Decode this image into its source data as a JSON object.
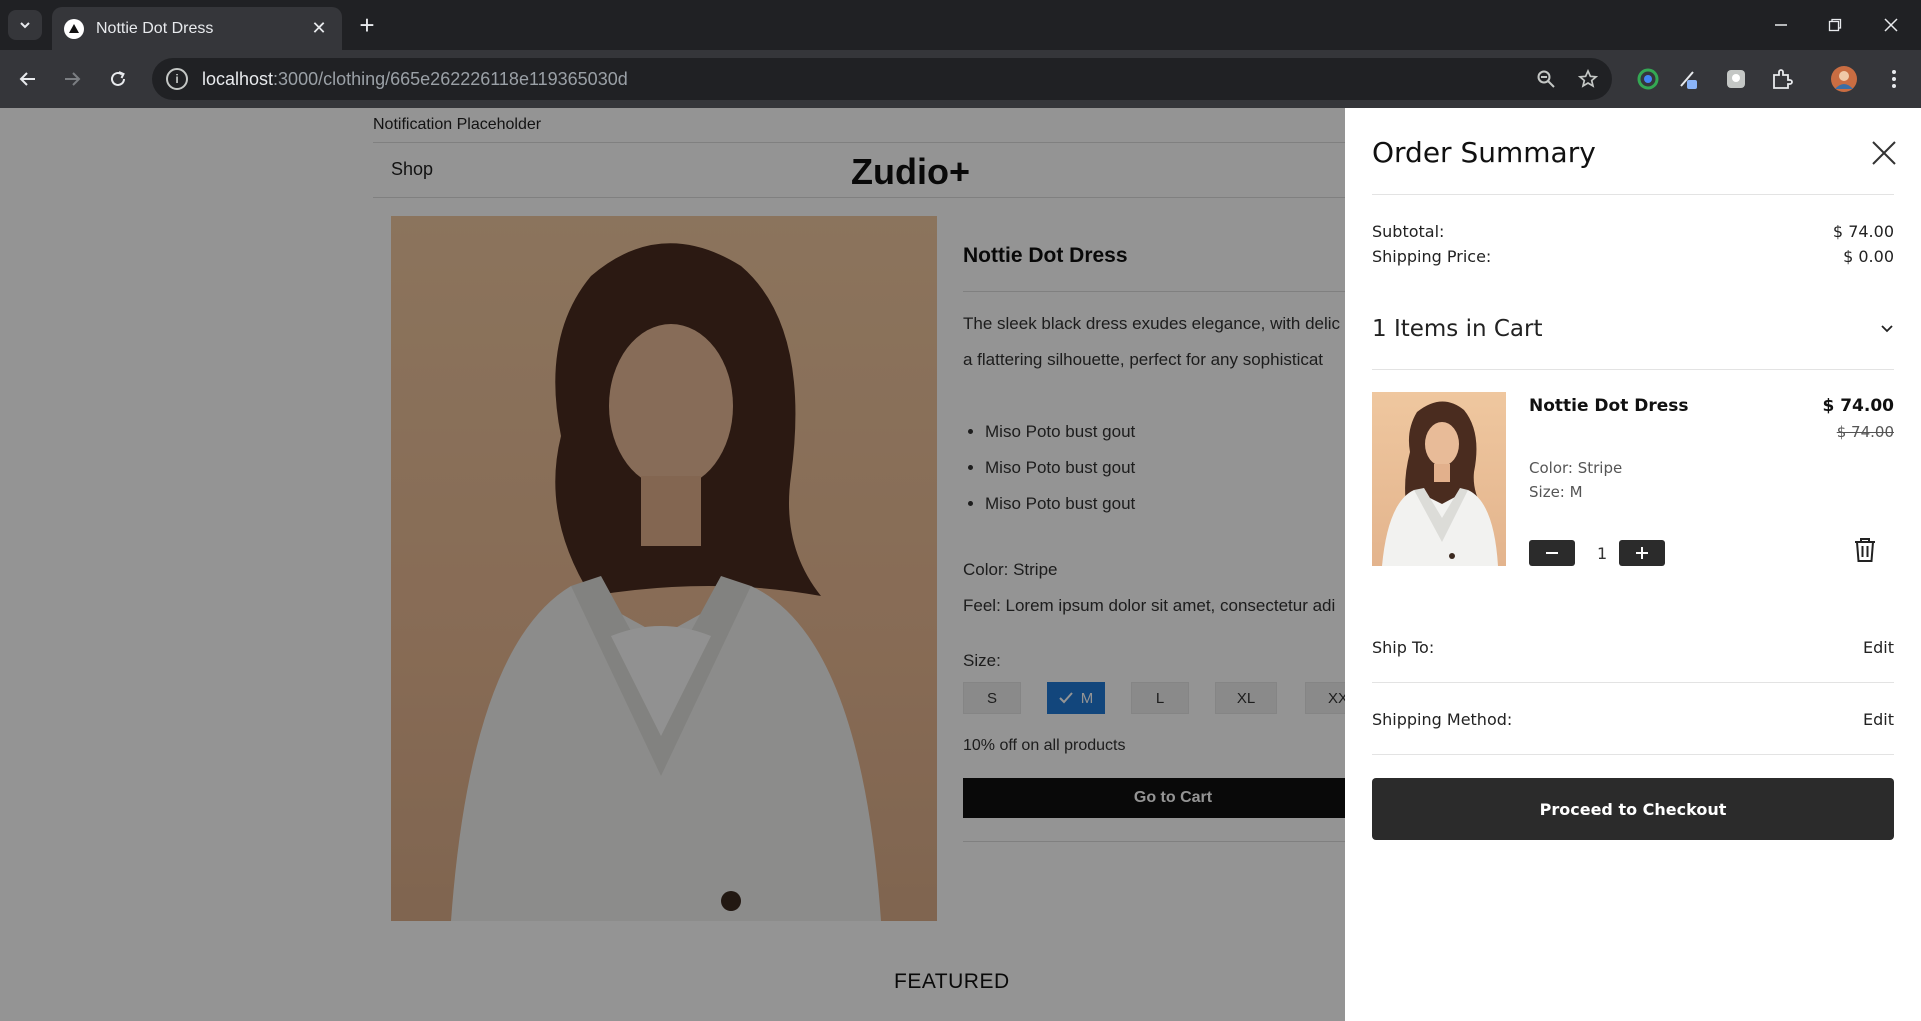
{
  "browser": {
    "tab_title": "Nottie Dot Dress",
    "url_host": "localhost",
    "url_path": ":3000/clothing/665e262226118e119365030d"
  },
  "page": {
    "notification": "Notification Placeholder",
    "nav_shop": "Shop",
    "logo": "Zudio+",
    "product": {
      "title": "Nottie Dot Dress",
      "description_line1": "The sleek black dress exudes elegance, with delic",
      "description_line2": "a flattering silhouette, perfect for any sophisticat",
      "bullets": [
        "Miso Poto bust gout",
        "Miso Poto bust gout",
        "Miso Poto bust gout"
      ],
      "color": "Color: Stripe",
      "feel": "Feel: Lorem ipsum dolor sit amet, consectetur adi",
      "size_label": "Size:",
      "sizes": [
        "S",
        "M",
        "L",
        "XL",
        "XX"
      ],
      "selected_size": "M",
      "promo": "10% off on all products",
      "go_to_cart": "Go to Cart"
    },
    "featured": "FEATURED"
  },
  "drawer": {
    "title": "Order Summary",
    "subtotal_label": "Subtotal:",
    "subtotal_value": "$ 74.00",
    "shipping_label": "Shipping Price:",
    "shipping_value": "$ 0.00",
    "items_in_cart": "1 Items in Cart",
    "item": {
      "name": "Nottie Dot Dress",
      "price": "$ 74.00",
      "original_price": "$ 74.00",
      "color": "Color: Stripe",
      "size": "Size: M",
      "quantity": "1"
    },
    "ship_to_label": "Ship To:",
    "ship_to_edit": "Edit",
    "shipping_method_label": "Shipping Method:",
    "shipping_method_edit": "Edit",
    "checkout": "Proceed to Checkout"
  },
  "colors": {
    "selected_size": "#1f79d6",
    "button_dark": "#2b2b2b",
    "browser_bg": "#202124"
  }
}
